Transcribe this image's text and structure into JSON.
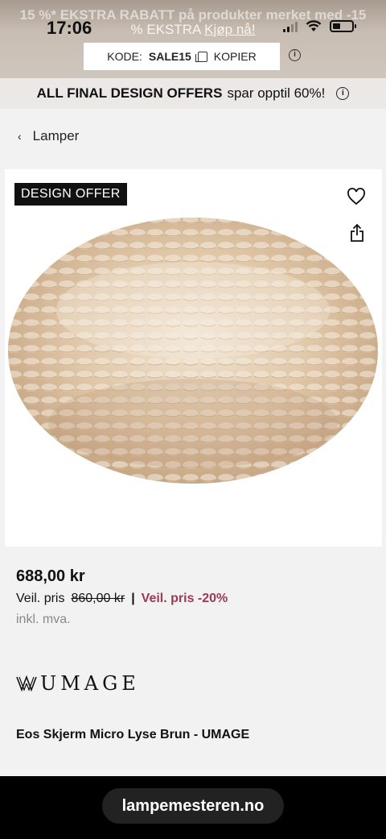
{
  "status_bar": {
    "time": "17:06"
  },
  "promo": {
    "line1": "15 %* EKSTRA RABATT på produkter merket med -15",
    "line2_text": "% EKSTRA",
    "line2_link": "Kjøp nå!",
    "code_label": "KODE:",
    "code_value": "SALE15",
    "copy_label": "KOPIER"
  },
  "offers_bar": {
    "bold_text": "ALL FINAL DESIGN OFFERS",
    "text": "spar opptil 60%!"
  },
  "breadcrumb": {
    "label": "Lamper"
  },
  "product": {
    "badge": "DESIGN OFFER",
    "price": "688,00 kr",
    "veil_label": "Veil. pris",
    "veil_price": "860,00 kr",
    "separator": "|",
    "discount": "Veil. pris -20%",
    "vat": "inkl. mva.",
    "brand": "UMAGE",
    "name": "Eos Skjerm Micro Lyse Brun - UMAGE"
  },
  "browser": {
    "url": "lampemesteren.no"
  },
  "colors": {
    "discount": "#9a3b55",
    "badge_bg": "#111111"
  }
}
